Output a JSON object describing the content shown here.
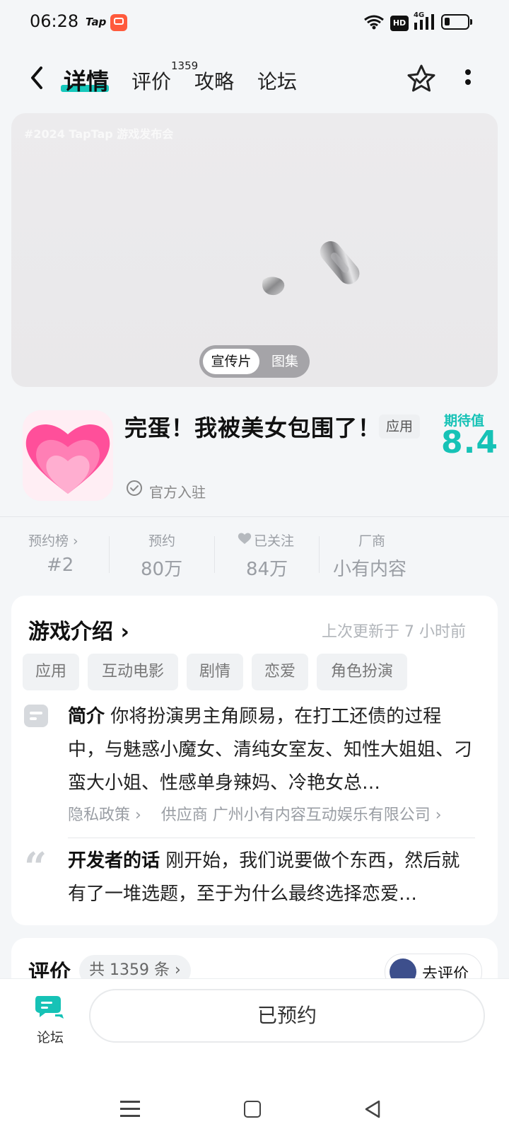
{
  "status_bar": {
    "time": "06:28",
    "tap_logo": "Tap",
    "hd": "HD",
    "network": "4G"
  },
  "nav": {
    "tabs": [
      {
        "label": "详情",
        "active": true
      },
      {
        "label": "评价",
        "badge": "1359"
      },
      {
        "label": "攻略"
      },
      {
        "label": "论坛"
      }
    ]
  },
  "media": {
    "watermark": "#2024 TapTap 游戏发布会",
    "toggle_promo": "宣传片",
    "toggle_gallery": "图集"
  },
  "app": {
    "title": "完蛋！我被美女包围了！",
    "category_badge": "应用",
    "expect_label": "期待值",
    "expect_value": "8.4",
    "verified_text": "官方入驻"
  },
  "stats": [
    {
      "label": "预约榜 ›",
      "value": "#2"
    },
    {
      "label": "预约",
      "value": "80万"
    },
    {
      "label": "已关注",
      "value": "84万"
    },
    {
      "label": "厂商",
      "value": "小有内容"
    }
  ],
  "intro": {
    "title": "游戏介绍 ›",
    "updated": "上次更新于 7 小时前",
    "tags": [
      "应用",
      "互动电影",
      "剧情",
      "恋爱",
      "角色扮演"
    ],
    "summary_label": "简介",
    "summary_text": "你将扮演男主角顾易，在打工还债的过程中，与魅惑小魔女、清纯女室友、知性大姐姐、刁蛮大小姐、性感单身辣妈、冷艳女总…",
    "privacy_link": "隐私政策 ›",
    "supplier_link": "供应商 广州小有内容互动娱乐有限公司 ›",
    "dev_label": "开发者的话",
    "dev_text": "刚开始，我们说要做个东西，然后就有了一堆选题，至于为什么最终选择恋爱…"
  },
  "reviews": {
    "title": "评价",
    "count": "共 1359 条 ›",
    "go_review": "去评价"
  },
  "bottom": {
    "forum_label": "论坛",
    "reserved_button": "已预约"
  },
  "colors": {
    "accent": "#16c2b6",
    "background": "#f4f6f8",
    "muted_text": "#9a9ea4"
  }
}
